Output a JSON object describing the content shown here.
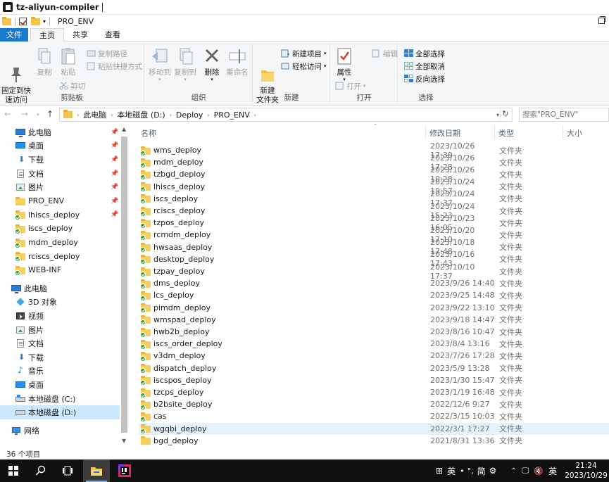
{
  "app": {
    "title": "tz-aliyun-compiler"
  },
  "window": {
    "title": "PRO_ENV"
  },
  "tabs": [
    {
      "label": "文件"
    },
    {
      "label": "主页"
    },
    {
      "label": "共享"
    },
    {
      "label": "查看"
    }
  ],
  "ribbon": {
    "clipboard": {
      "label": "剪贴板",
      "pin_quick_access": "固定到快\n速访问",
      "copy": "复制",
      "paste": "粘贴",
      "copy_path": "复制路径",
      "paste_shortcut": "粘贴快捷方式",
      "cut": "剪切"
    },
    "organize": {
      "label": "组织",
      "move_to": "移动到",
      "copy_to": "复制到",
      "delete": "删除",
      "rename": "重命名"
    },
    "new": {
      "label": "新建",
      "new_folder": "新建\n文件夹",
      "new_item": "新建项目",
      "easy_access": "轻松访问"
    },
    "open": {
      "label": "打开",
      "properties": "属性",
      "open": "打开",
      "edit": "编辑"
    },
    "select": {
      "label": "选择",
      "select_all": "全部选择",
      "select_none": "全部取消",
      "invert": "反向选择"
    }
  },
  "address": {
    "crumbs": [
      "此电脑",
      "本地磁盘 (D:)",
      "Deploy",
      "PRO_ENV"
    ],
    "search_placeholder": "搜索\"PRO_ENV\""
  },
  "nav": {
    "quick_access": [
      {
        "label": "此电脑",
        "icon": "pc-icon",
        "pinned": true
      },
      {
        "label": "桌面",
        "icon": "desktop-icon",
        "pinned": true
      },
      {
        "label": "下载",
        "icon": "download-icon",
        "pinned": true
      },
      {
        "label": "文档",
        "icon": "document-icon",
        "pinned": true
      },
      {
        "label": "图片",
        "icon": "picture-icon",
        "pinned": true
      },
      {
        "label": "PRO_ENV",
        "icon": "folder-icon",
        "pinned": true
      },
      {
        "label": "lhiscs_deploy",
        "icon": "synced-folder-icon",
        "pinned": true
      },
      {
        "label": "iscs_deploy",
        "icon": "synced-folder-icon",
        "pinned": false
      },
      {
        "label": "mdm_deploy",
        "icon": "synced-folder-icon",
        "pinned": false
      },
      {
        "label": "rciscs_deploy",
        "icon": "synced-folder-icon",
        "pinned": false
      },
      {
        "label": "WEB-INF",
        "icon": "synced-folder-icon",
        "pinned": false
      }
    ],
    "this_pc_label": "此电脑",
    "this_pc": [
      {
        "label": "3D 对象",
        "icon": "3d-objects-icon"
      },
      {
        "label": "视频",
        "icon": "video-icon"
      },
      {
        "label": "图片",
        "icon": "picture-icon"
      },
      {
        "label": "文档",
        "icon": "document-icon"
      },
      {
        "label": "下载",
        "icon": "download-icon"
      },
      {
        "label": "音乐",
        "icon": "music-icon"
      },
      {
        "label": "桌面",
        "icon": "desktop-icon"
      },
      {
        "label": "本地磁盘 (C:)",
        "icon": "drive-c-icon"
      },
      {
        "label": "本地磁盘 (D:)",
        "icon": "drive-d-icon",
        "selected": true
      }
    ],
    "network": "网络"
  },
  "list": {
    "headers": {
      "name": "名称",
      "date": "修改日期",
      "type": "类型",
      "size": "大小"
    },
    "rows": [
      {
        "name": "wms_deploy",
        "date": "2023/10/26 17:39",
        "type": "文件夹",
        "synced": true
      },
      {
        "name": "mdm_deploy",
        "date": "2023/10/26 17:28",
        "type": "文件夹",
        "synced": true
      },
      {
        "name": "tzbgd_deploy",
        "date": "2023/10/26 10:28",
        "type": "文件夹",
        "synced": true
      },
      {
        "name": "lhiscs_deploy",
        "date": "2023/10/24 19:57",
        "type": "文件夹",
        "synced": true
      },
      {
        "name": "iscs_deploy",
        "date": "2023/10/24 17:37",
        "type": "文件夹",
        "synced": true
      },
      {
        "name": "rciscs_deploy",
        "date": "2023/10/24 15:23",
        "type": "文件夹",
        "synced": true
      },
      {
        "name": "tzpos_deploy",
        "date": "2023/10/23 16:05",
        "type": "文件夹",
        "synced": true
      },
      {
        "name": "rcmdm_deploy",
        "date": "2023/10/20 17:10",
        "type": "文件夹",
        "synced": true
      },
      {
        "name": "hwsaas_deploy",
        "date": "2023/10/18 17:48",
        "type": "文件夹",
        "synced": true
      },
      {
        "name": "desktop_deploy",
        "date": "2023/10/16 17:43",
        "type": "文件夹",
        "synced": true
      },
      {
        "name": "tzpay_deploy",
        "date": "2023/10/10 17:37",
        "type": "文件夹",
        "synced": true
      },
      {
        "name": "dms_deploy",
        "date": "2023/9/26 14:40",
        "type": "文件夹",
        "synced": true
      },
      {
        "name": "lcs_deploy",
        "date": "2023/9/25 14:48",
        "type": "文件夹",
        "synced": true
      },
      {
        "name": "pimdm_deploy",
        "date": "2023/9/22 13:10",
        "type": "文件夹",
        "synced": true
      },
      {
        "name": "wmspad_deploy",
        "date": "2023/9/18 14:47",
        "type": "文件夹",
        "synced": true
      },
      {
        "name": "hwb2b_deploy",
        "date": "2023/8/16 10:47",
        "type": "文件夹",
        "synced": true
      },
      {
        "name": "iscs_order_deploy",
        "date": "2023/8/4 13:16",
        "type": "文件夹",
        "synced": true
      },
      {
        "name": "v3dm_deploy",
        "date": "2023/7/26 17:28",
        "type": "文件夹",
        "synced": true
      },
      {
        "name": "dispatch_deploy",
        "date": "2023/5/9 13:28",
        "type": "文件夹",
        "synced": true
      },
      {
        "name": "iscspos_deploy",
        "date": "2023/1/30 15:47",
        "type": "文件夹",
        "synced": true
      },
      {
        "name": "tzcps_deploy",
        "date": "2023/1/19 16:48",
        "type": "文件夹",
        "synced": true
      },
      {
        "name": "b2bsite_deploy",
        "date": "2022/12/6 9:27",
        "type": "文件夹",
        "synced": true
      },
      {
        "name": "cas",
        "date": "2022/3/15 10:03",
        "type": "文件夹",
        "synced": true
      },
      {
        "name": "wgqbi_deploy",
        "date": "2022/3/1 17:27",
        "type": "文件夹",
        "synced": true,
        "hover": true
      },
      {
        "name": "bgd_deploy",
        "date": "2021/8/31 13:36",
        "type": "文件夹",
        "synced": false
      }
    ]
  },
  "status": {
    "count": "36 个项目"
  },
  "taskbar": {
    "tray_text": [
      "英",
      "简",
      "英"
    ],
    "time": "21:24",
    "date": "2023/10/29"
  }
}
